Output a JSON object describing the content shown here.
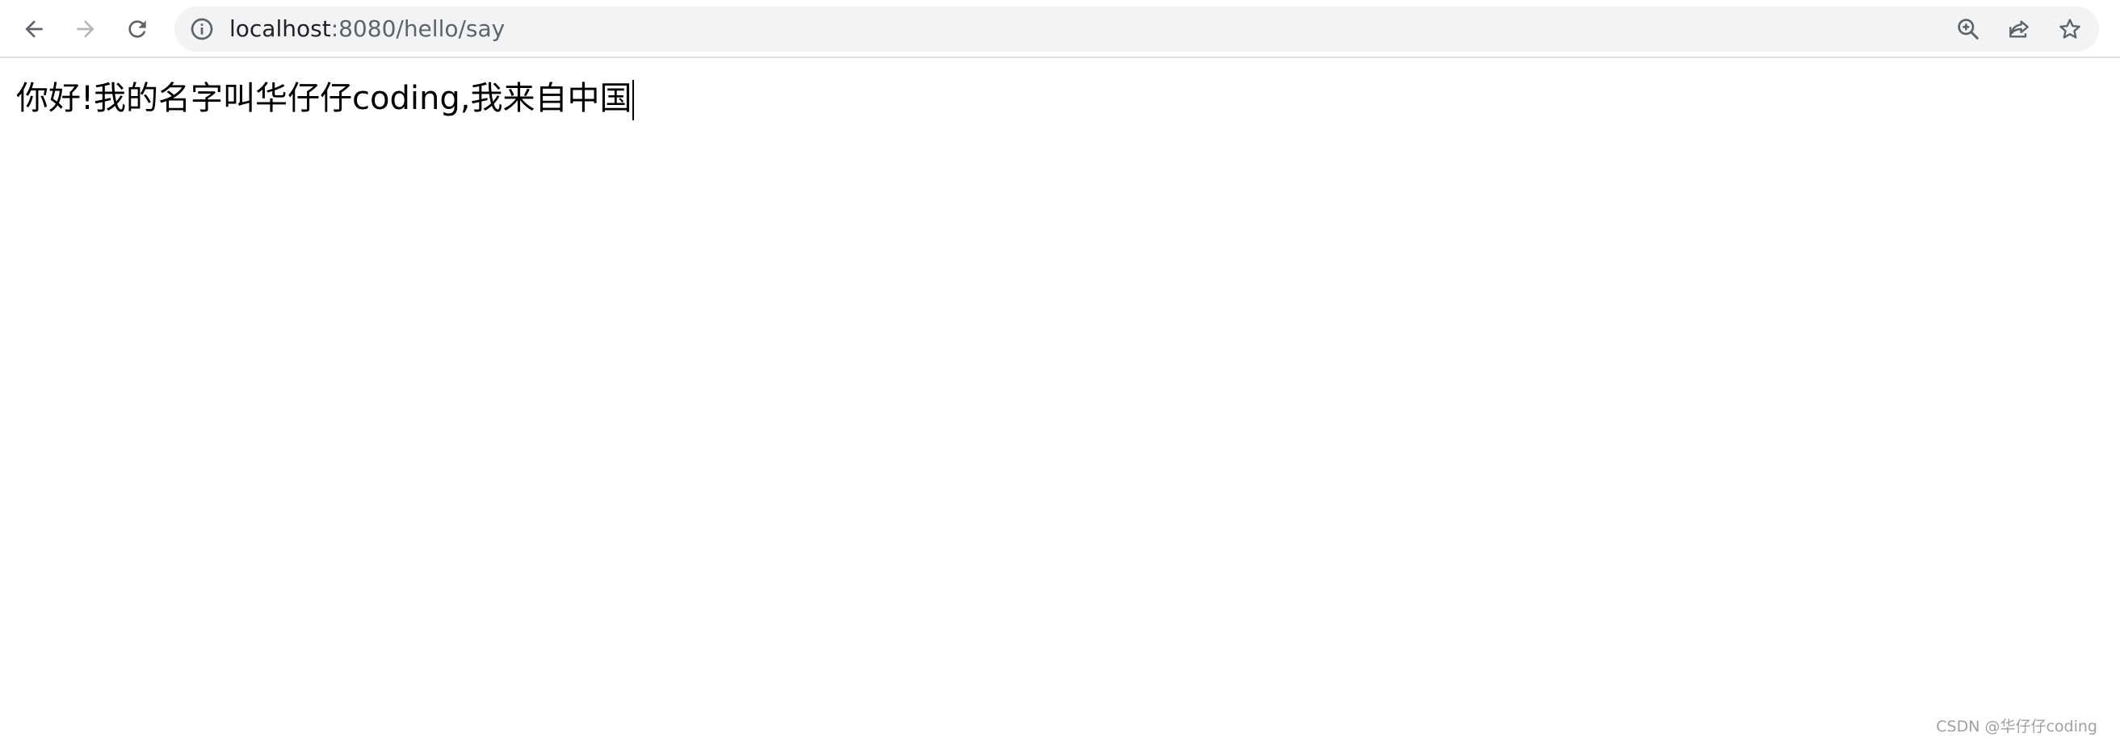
{
  "browser": {
    "nav": {
      "back_icon": "arrow-left-icon",
      "forward_icon": "arrow-right-icon",
      "reload_icon": "reload-icon"
    },
    "omnibox": {
      "info_icon": "info-icon",
      "url_host": "localhost",
      "url_path": ":8080/hello/say",
      "zoom_icon": "zoom-in-icon",
      "share_icon": "share-icon",
      "bookmark_icon": "star-icon"
    },
    "colors": {
      "omnibox_bg": "#f1f3f4",
      "icon": "#5f6368",
      "icon_disabled": "#b5b8bb"
    }
  },
  "page": {
    "body_text": "你好!我的名字叫华仔仔coding,我来自中国"
  },
  "watermark": {
    "text": "CSDN @华仔仔coding"
  }
}
